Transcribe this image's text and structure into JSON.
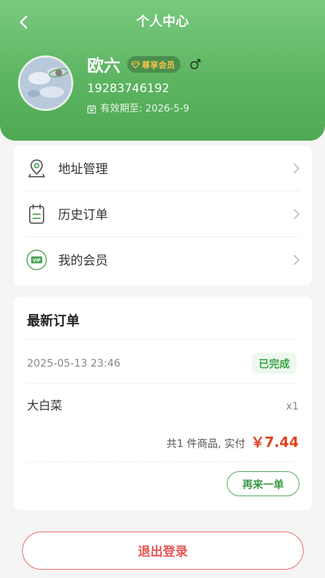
{
  "header": {
    "title": "个人中心",
    "back_icon": "chevron-left-icon"
  },
  "profile": {
    "name": "欧六",
    "vip_badge": "尊享会员",
    "gender_icon": "male-icon",
    "phone": "19283746192",
    "expire_label": "有效期至: 2026-5-9"
  },
  "menu": {
    "items": [
      {
        "label": "地址管理",
        "icon": "location-pin-icon"
      },
      {
        "label": "历史订单",
        "icon": "clipboard-icon"
      },
      {
        "label": "我的会员",
        "icon": "vip-card-icon"
      }
    ]
  },
  "latest_order": {
    "title": "最新订单",
    "date": "2025-05-13 23:46",
    "status": "已完成",
    "item_name": "大白菜",
    "item_qty": "x1",
    "summary_label": "共1 件商品, 实付",
    "amount": "￥7.44",
    "reorder_label": "再来一单"
  },
  "logout_label": "退出登录",
  "colors": {
    "header_green": "#5db562",
    "status_green": "#3aa447",
    "price_red": "#e0431f",
    "logout_red": "#e65757"
  }
}
